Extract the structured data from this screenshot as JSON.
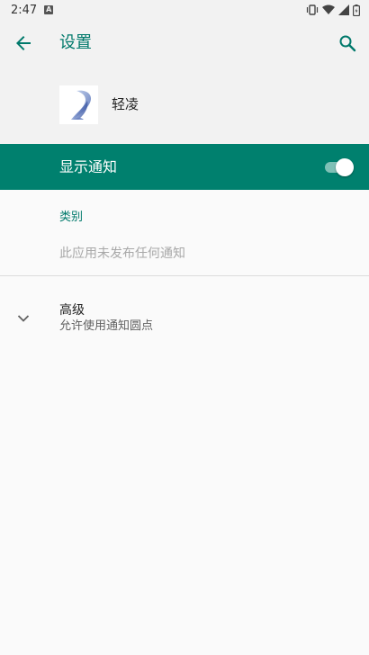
{
  "status_bar": {
    "time": "2:47",
    "notification_icons": [
      "a-icon"
    ],
    "system_icons": [
      "vibrate-icon",
      "wifi-icon",
      "signal-icon",
      "battery-icon"
    ]
  },
  "app_bar": {
    "title": "设置",
    "back_icon": "arrow-back-icon",
    "search_icon": "search-icon"
  },
  "app_header": {
    "name": "轻凌",
    "icon": "app-logo-icon"
  },
  "master_switch": {
    "label": "显示通知",
    "checked": true
  },
  "category_section": {
    "header": "类别",
    "empty_message": "此应用未发布任何通知"
  },
  "advanced": {
    "title": "高级",
    "summary": "允许使用通知圆点",
    "icon": "chevron-down-icon"
  },
  "colors": {
    "accent": "#00796b",
    "switch_bar": "#00806e",
    "background": "#fafafa",
    "header_background": "#f2f2f2"
  }
}
